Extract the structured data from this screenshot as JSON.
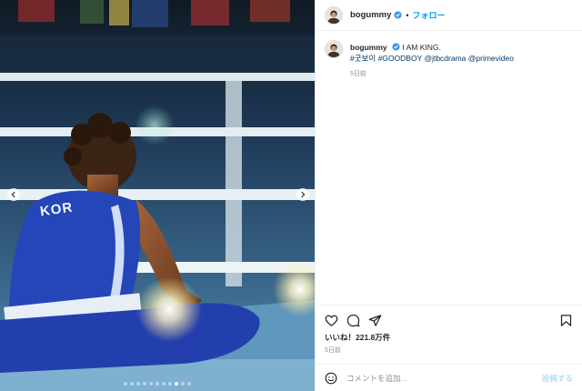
{
  "post": {
    "username": "bogummy",
    "verified": true,
    "separator": "•",
    "follow_label": "フォロー",
    "caption_text": "I AM KING.",
    "hashtags": [
      "#굿보이",
      "#GOODBOY",
      "@jtbcdrama",
      "@primevideo"
    ],
    "caption_age": "5日前",
    "likes": "いいね！221.8万件",
    "post_age": "5日前"
  },
  "media": {
    "jersey_text": "KOR",
    "slide_count": 11,
    "active_slide": 8
  },
  "comment": {
    "placeholder": "コメントを追加...",
    "post_label": "投稿する"
  },
  "icons": [
    "verified-badge-icon",
    "heart-icon",
    "comment-icon",
    "share-icon",
    "bookmark-icon",
    "emoji-icon",
    "chevron-left-icon",
    "chevron-right-icon"
  ],
  "colors": {
    "link": "#0095f6",
    "hashtag": "#00376b",
    "verified": "#3897f0",
    "muted": "#8e8e8e",
    "jersey": "#2446b8"
  }
}
